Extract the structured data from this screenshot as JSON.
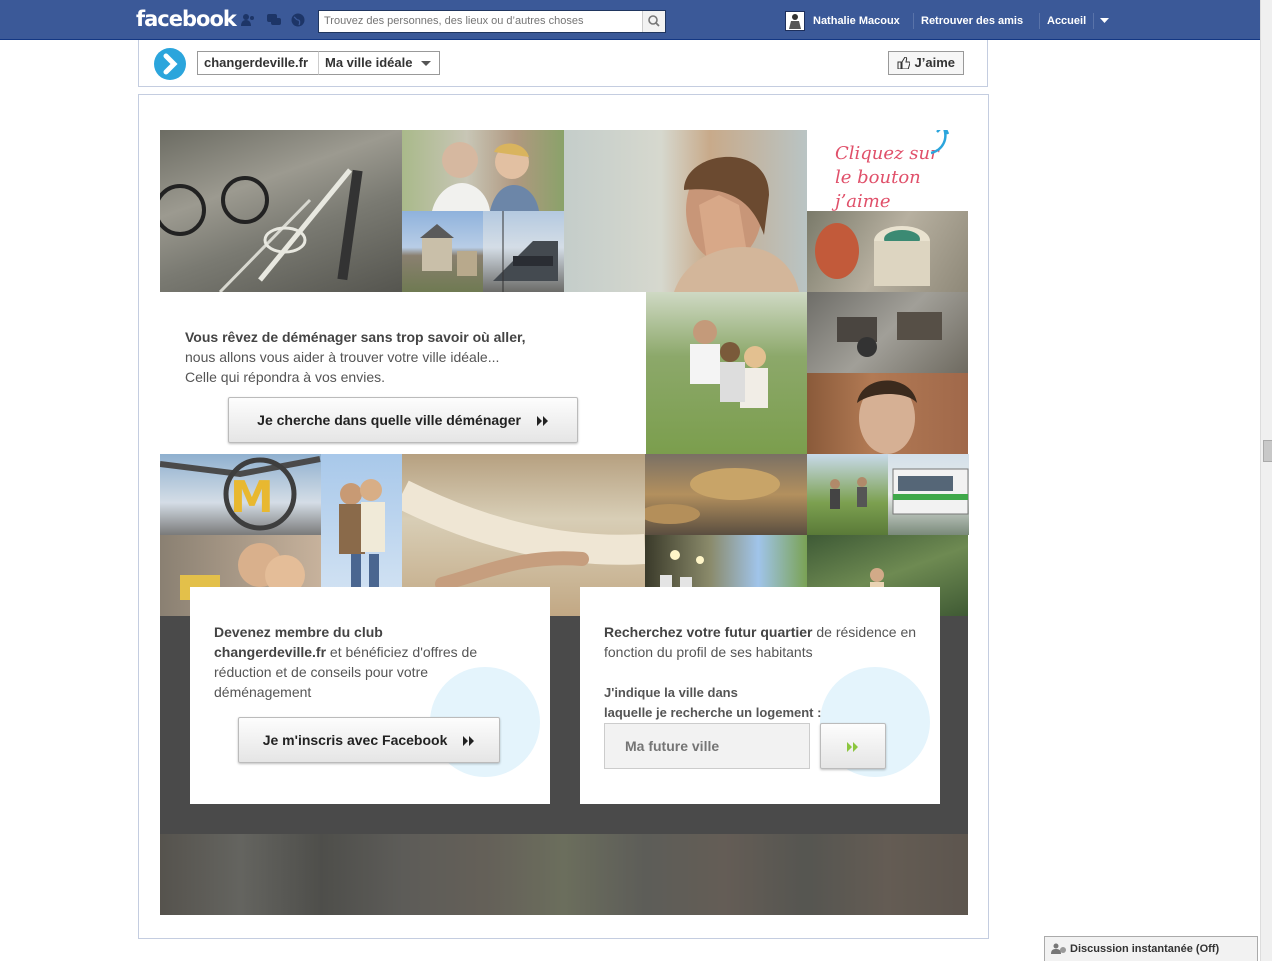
{
  "topbar": {
    "logo": "facebook",
    "search_placeholder": "Trouvez des personnes, des lieux ou d’autres choses",
    "user_name": "Nathalie Macoux",
    "find_friends": "Retrouver des amis",
    "home": "Accueil"
  },
  "page_header": {
    "app_name": "changerdeville.fr",
    "tab_name": "Ma ville idéale",
    "like_label": "J’aime"
  },
  "hero": {
    "click_hint_line1": "Cliquez sur",
    "click_hint_line2": "le bouton j’aime"
  },
  "intro": {
    "headline": "Vous rêvez de déménager sans trop savoir où aller,",
    "line2": "nous allons vous aider à trouver votre ville idéale...",
    "line3": "Celle qui répondra à vos envies.",
    "button_label": "Je cherche dans quelle ville déménager"
  },
  "club_card": {
    "title_bold": "Devenez membre du club",
    "brand_bold": "changerdeville.fr",
    "text_rest": " et bénéficiez d'offres de réduction et de conseils pour votre déménagement",
    "button_label": "Je m'inscris avec Facebook"
  },
  "search_card": {
    "title_bold": "Recherchez votre futur quartier",
    "title_rest": " de résidence en fonction du profil de ses habitants",
    "prompt_line1": "J'indique la ville dans",
    "prompt_line2": "laquelle je recherche un logement :",
    "input_placeholder": "Ma future ville"
  },
  "chat": {
    "label": "Discussion instantanée (Off)"
  },
  "colors": {
    "facebook_blue": "#3b5998",
    "brand_cyan": "#2ba5dc",
    "hint_pink": "#e0506a",
    "dark_panel": "#4a4a4a"
  }
}
